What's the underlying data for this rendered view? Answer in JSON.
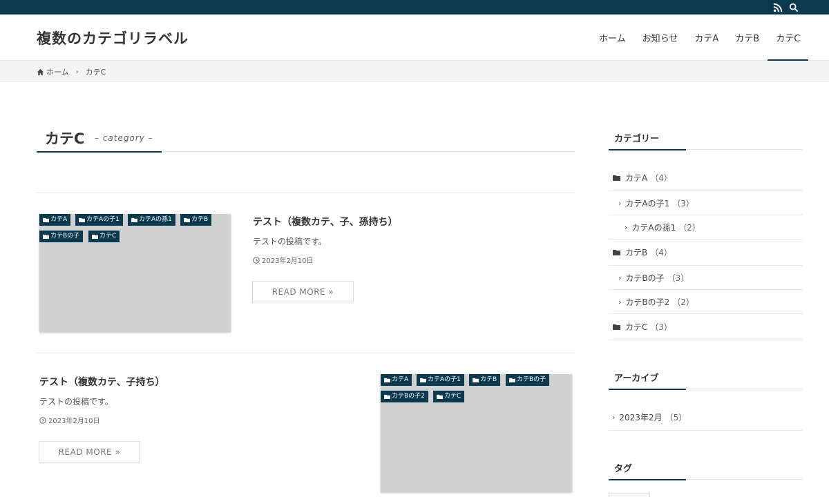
{
  "header": {
    "site_title": "複数のカテゴリラベル",
    "nav": [
      {
        "label": "ホーム"
      },
      {
        "label": "お知らせ"
      },
      {
        "label": "カテA"
      },
      {
        "label": "カテB"
      },
      {
        "label": "カテC",
        "active": true
      }
    ]
  },
  "breadcrumb": {
    "home": "ホーム",
    "current": "カテC"
  },
  "archive": {
    "title": "カテC",
    "subtitle": "– category –"
  },
  "posts": [
    {
      "title": "テスト（複数カテ、子、孫持ち）",
      "excerpt": "テストの投稿です。",
      "date": "2023年2月10日",
      "read_more": "READ MORE »",
      "tags": [
        "カテA",
        "カテAの子1",
        "カテAの孫1",
        "カテB",
        "カテBの子",
        "カテC"
      ]
    },
    {
      "title": "テスト（複数カテ、子持ち）",
      "excerpt": "テストの投稿です。",
      "date": "2023年2月10日",
      "read_more": "READ MORE »",
      "tags": [
        "カテA",
        "カテAの子1",
        "カテB",
        "カテBの子",
        "カテBの子2",
        "カテC"
      ]
    }
  ],
  "sidebar": {
    "categories": {
      "title": "カテゴリー",
      "items": [
        {
          "label": "カテA",
          "count": "（4）",
          "level": 0
        },
        {
          "label": "カテAの子1",
          "count": "（3）",
          "level": 1
        },
        {
          "label": "カテAの孫1",
          "count": "（2）",
          "level": 2
        },
        {
          "label": "カテB",
          "count": "（4）",
          "level": 0
        },
        {
          "label": "カテBの子",
          "count": "（3）",
          "level": 1
        },
        {
          "label": "カテBの子2",
          "count": "（2）",
          "level": 1
        },
        {
          "label": "カテC",
          "count": "（3）",
          "level": 0
        }
      ]
    },
    "archives": {
      "title": "アーカイブ",
      "items": [
        {
          "label": "2023年2月",
          "count": "（5）"
        }
      ]
    },
    "tags": {
      "title": "タグ"
    }
  },
  "icons": {
    "rss": "rss-icon",
    "search": "search-icon",
    "home": "home-icon",
    "folder": "folder-icon",
    "clock": "clock-icon",
    "chevron": "chevron-right-icon"
  },
  "colors": {
    "brand": "#0b3a4f",
    "thumbnail": "#d2d2d2"
  }
}
